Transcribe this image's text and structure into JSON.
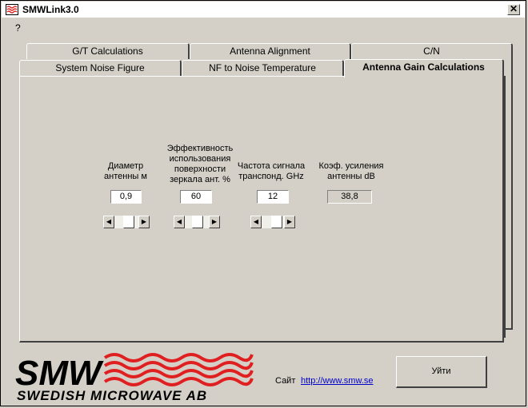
{
  "window": {
    "title": "SMWLink3.0",
    "close_glyph": "✕",
    "app_icon": "smw-wave-icon"
  },
  "menu": {
    "help": "?"
  },
  "tabs_back": [
    {
      "label": "G/T Calculations"
    },
    {
      "label": "Antenna Alignment"
    },
    {
      "label": "C/N"
    }
  ],
  "tabs_front": [
    {
      "label": "System Noise Figure"
    },
    {
      "label": "NF to Noise Temperature"
    },
    {
      "label": "Antenna Gain Calculations",
      "active": true
    }
  ],
  "panel": {
    "diameter": {
      "label": "Диаметр антенны  м",
      "value": "0,9",
      "slider_position": 0.3
    },
    "efficiency": {
      "label": "Эффективность использования поверхности зеркала ант. %",
      "value": "60",
      "slider_position": 0.55
    },
    "frequency": {
      "label": "Частота сигнала транспонд. GHz",
      "value": "12",
      "slider_position": 0.5
    },
    "gain": {
      "label": "Коэф. усиления антенны dB",
      "value": "38,8"
    }
  },
  "footer": {
    "logo_top": "SMW",
    "logo_bottom": "SWEDISH MICROWAVE AB",
    "logo_color": "#e02020",
    "site_label": "Сайт",
    "site_url": "http://www.smw.se",
    "exit_label": "Уйти"
  }
}
